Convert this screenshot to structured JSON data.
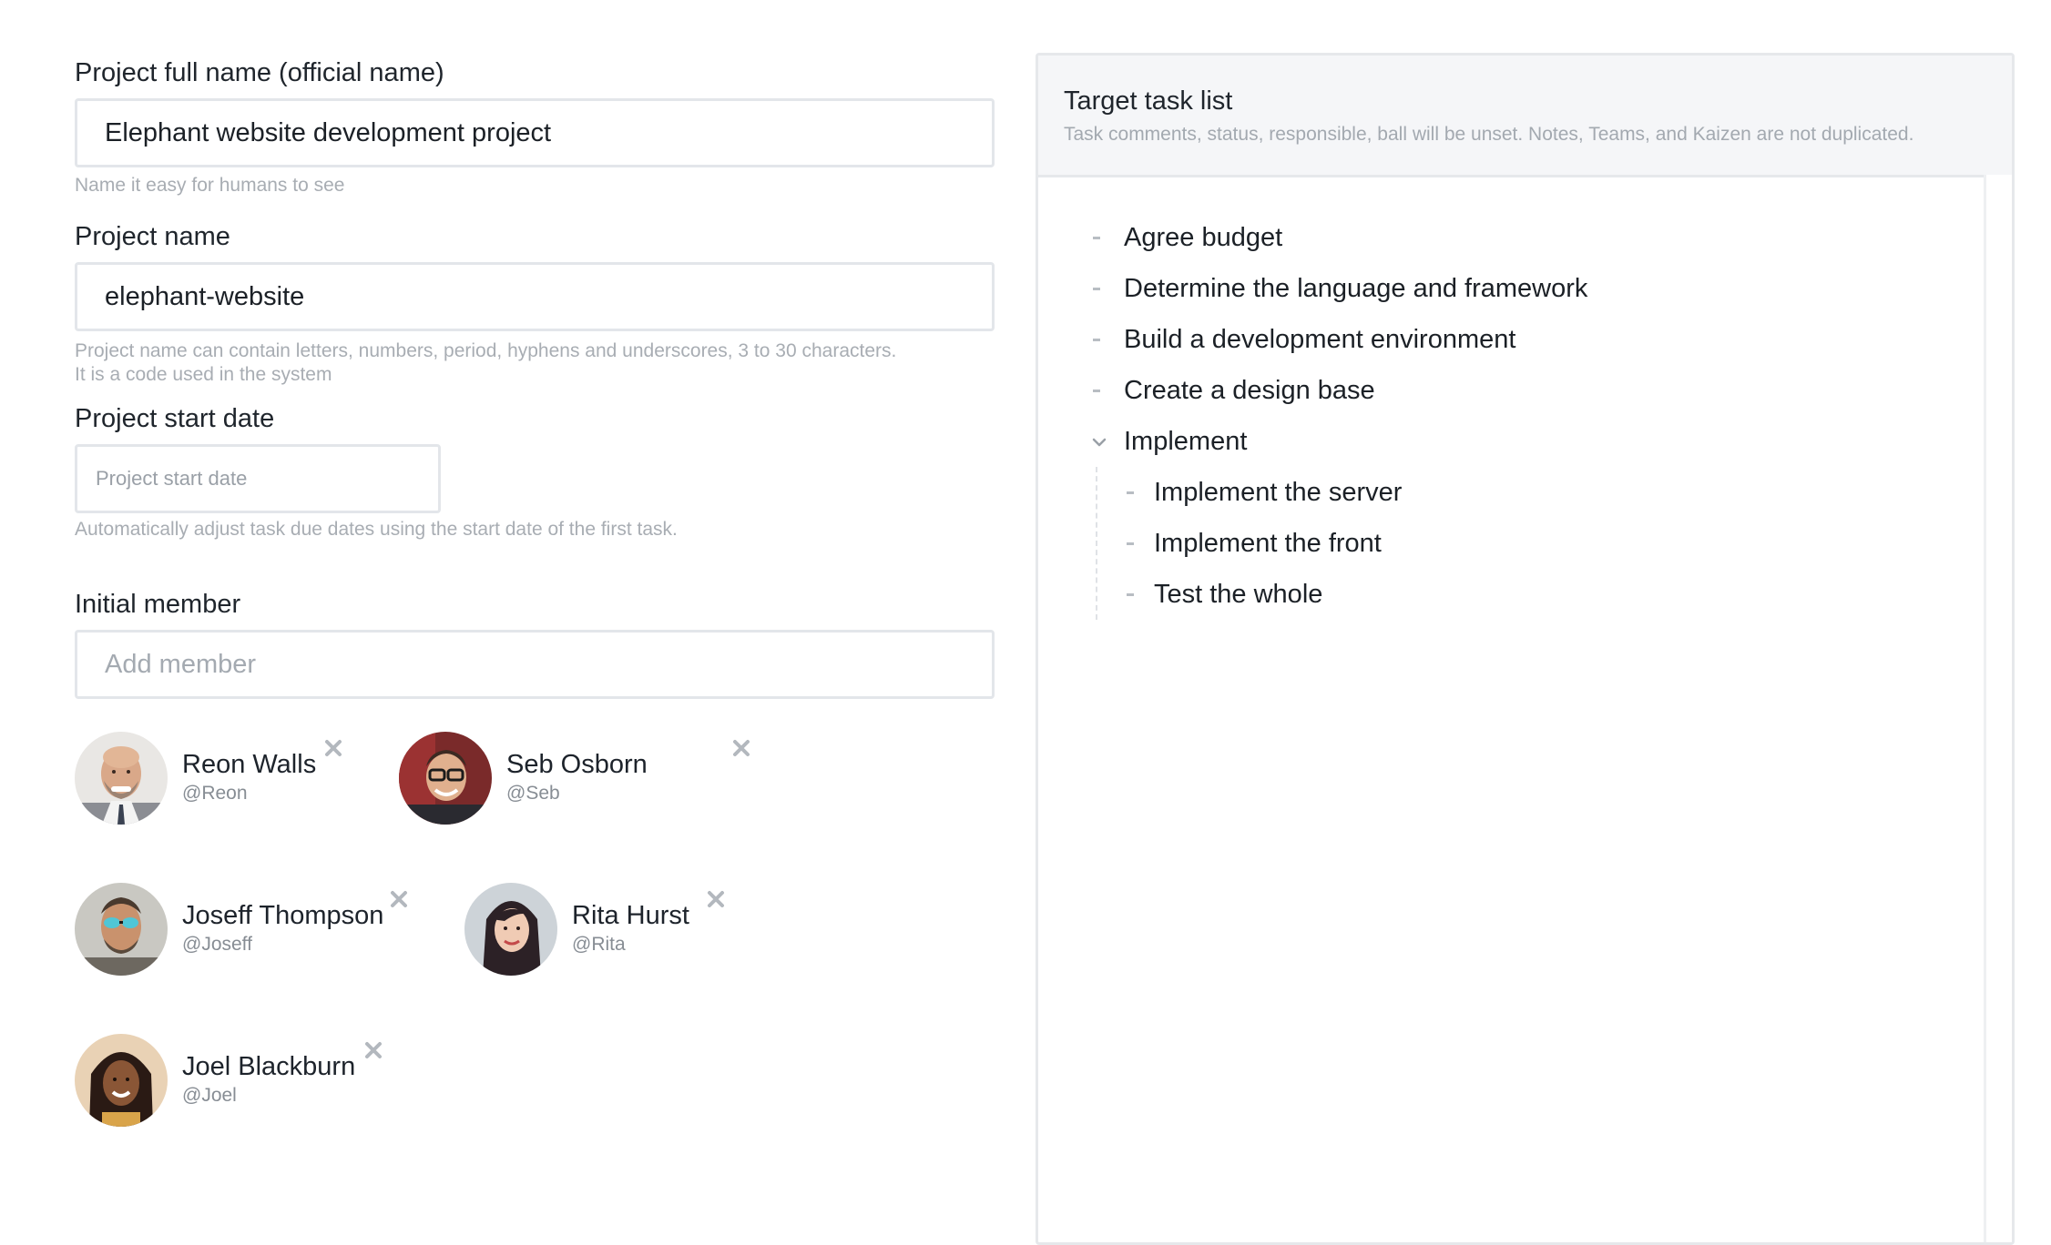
{
  "form": {
    "full_name": {
      "label": "Project full name (official name)",
      "value": "Elephant website development project",
      "help": "Name it easy for humans to see"
    },
    "project_name": {
      "label": "Project name",
      "value": "elephant-website",
      "help_line1": "Project name can contain letters, numbers, period, hyphens and underscores, 3 to 30 characters.",
      "help_line2": "It is a code used in the system"
    },
    "start_date": {
      "label": "Project start date",
      "placeholder": "Project start date",
      "help": "Automatically adjust task due dates using the start date of the first task."
    },
    "initial_member": {
      "label": "Initial member",
      "placeholder": "Add member"
    }
  },
  "members": [
    {
      "name": "Reon Walls",
      "handle": "@Reon"
    },
    {
      "name": "Seb Osborn",
      "handle": "@Seb"
    },
    {
      "name": "Joseff Thompson",
      "handle": "@Joseff"
    },
    {
      "name": "Rita Hurst",
      "handle": "@Rita"
    },
    {
      "name": "Joel Blackburn",
      "handle": "@Joel"
    }
  ],
  "task_panel": {
    "title": "Target task list",
    "subtitle": "Task comments, status, responsible, ball will be unset. Notes, Teams, and Kaizen are not duplicated.",
    "tasks": [
      {
        "label": "Agree budget"
      },
      {
        "label": "Determine the language and framework"
      },
      {
        "label": "Build a development environment"
      },
      {
        "label": "Create a design base"
      },
      {
        "label": "Implement",
        "expanded": true,
        "children": [
          {
            "label": "Implement the server"
          },
          {
            "label": "Implement the front"
          },
          {
            "label": "Test the whole"
          }
        ]
      }
    ]
  },
  "colors": {
    "border": "#e3e6ea",
    "help_text": "#a8adb3",
    "panel_header_bg": "#f5f6f8",
    "remove_icon": "#b3b8be"
  },
  "icons": {
    "remove": "close-icon",
    "expand": "chevron-down-icon",
    "bullet": "dash-bullet-icon"
  }
}
